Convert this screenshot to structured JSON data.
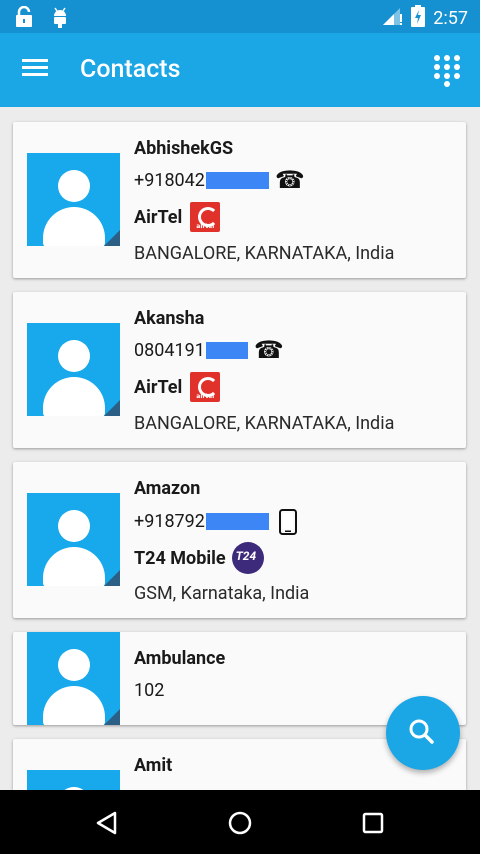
{
  "status_bar": {
    "time": "2:57",
    "left_icons": [
      "lock-open-icon",
      "android-debug-icon"
    ],
    "right_icons": [
      "signal-icon",
      "battery-charging-icon"
    ]
  },
  "app_bar": {
    "title": "Contacts",
    "menu_icon": "hamburger-menu-icon",
    "action_icon": "dialpad-icon"
  },
  "contacts": [
    {
      "name": "AbhishekGS",
      "number": "+918042",
      "number_masked": true,
      "number_type_icon": "landline-phone-icon",
      "carrier": "AirTel",
      "carrier_logo": "airtel-logo-icon",
      "location": "BANGALORE, KARNATAKA, India"
    },
    {
      "name": "Akansha",
      "number": "0804191",
      "number_masked": true,
      "number_type_icon": "landline-phone-icon",
      "carrier": "AirTel",
      "carrier_logo": "airtel-logo-icon",
      "location": "BANGALORE, KARNATAKA, India"
    },
    {
      "name": "Amazon",
      "number": "+918792",
      "number_masked": true,
      "number_type_icon": "mobile-phone-icon",
      "carrier": "T24 Mobile",
      "carrier_logo": "t24-logo-icon",
      "carrier_logo_text": "T24",
      "location": "GSM, Karnataka, India"
    },
    {
      "name": "Ambulance",
      "number": "102"
    },
    {
      "name": "Amit"
    }
  ],
  "fab": {
    "icon": "search-icon"
  },
  "nav_bar": {
    "icons": [
      "back-icon",
      "home-icon",
      "recents-icon"
    ]
  },
  "colors": {
    "status_bar": "#1590d0",
    "app_bar": "#1ba6e6",
    "avatar": "#18a9ec",
    "mask": "#3d86f5",
    "airtel_red": "#e0322b"
  }
}
